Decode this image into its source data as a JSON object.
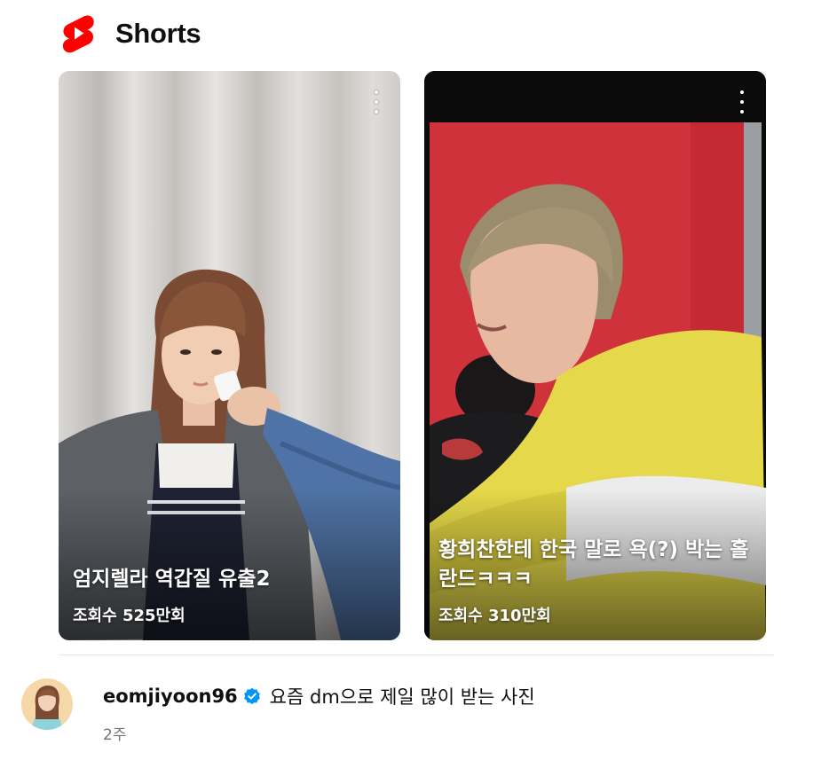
{
  "header": {
    "title": "Shorts",
    "logo_icon": "youtube-shorts-logo-icon",
    "brand_color": "#ff0000"
  },
  "shorts": [
    {
      "title": "엄지렐라 역갑질 유출2",
      "views": "조회수 525만회",
      "more_icon": "more-vert-icon"
    },
    {
      "title": "황희찬한테 한국 말로 욕(?) 박는 홀란드ㅋㅋㅋ",
      "views": "조회수 310만회",
      "more_icon": "more-vert-icon"
    }
  ],
  "post": {
    "username": "eomjiyoon96",
    "verified_icon": "verified-badge-icon",
    "verified_color": "#0095f6",
    "caption": "요즘 dm으로 제일 많이 받는 사진",
    "time": "2주"
  }
}
